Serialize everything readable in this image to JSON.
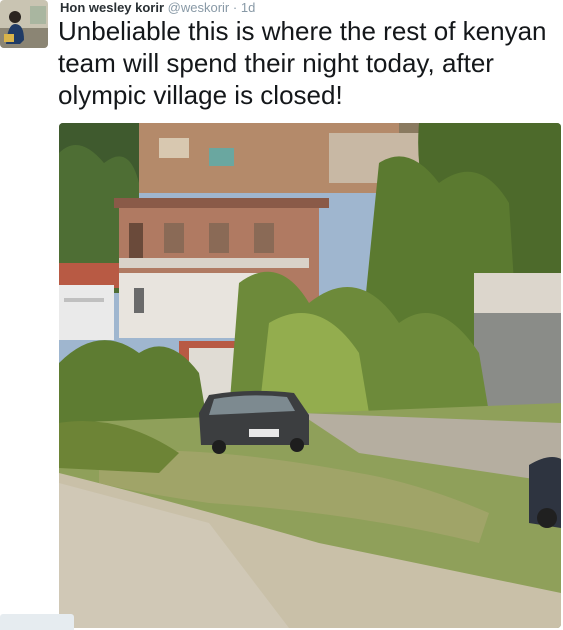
{
  "tweet": {
    "author_name": "Hon wesley korir",
    "author_handle": "@weskorir",
    "separator": "·",
    "timestamp": "1d",
    "text": "Unbeliable this is where the rest of kenyan team will spend their night today, after olympic village is closed!"
  },
  "colors": {
    "text": "#14171a",
    "muted": "#8899a6"
  },
  "media": {
    "icons": [
      "house-icon",
      "car-icon",
      "tree-icon"
    ]
  }
}
